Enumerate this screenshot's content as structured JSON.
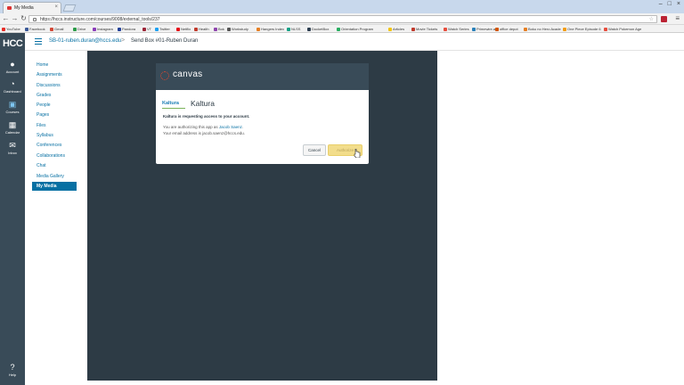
{
  "browser": {
    "tab_title": "My Media",
    "url": "https://hccs.instructure.com/courses/9008/external_tools/237",
    "bookmarks": [
      {
        "label": "YouTube",
        "color": "#e52d27"
      },
      {
        "label": "Facebook",
        "color": "#3b5998"
      },
      {
        "label": "Gmail",
        "color": "#d14836"
      },
      {
        "label": "Drive",
        "color": "#2b9b48"
      },
      {
        "label": "Instagram",
        "color": "#8a3ab9"
      },
      {
        "label": "Pandora",
        "color": "#224099"
      },
      {
        "label": "VT",
        "color": "#9b2335"
      },
      {
        "label": "Twitter",
        "color": "#1da1f2"
      },
      {
        "label": "Netflix",
        "color": "#e50914"
      },
      {
        "label": "Health",
        "color": "#c0392b"
      },
      {
        "label": "Bok",
        "color": "#8e44ad"
      },
      {
        "label": "Workstudy",
        "color": "#555555"
      },
      {
        "label": "Hangers Index",
        "color": "#e67e22"
      },
      {
        "label": "NLSS",
        "color": "#16a085"
      },
      {
        "label": "DocketBox",
        "color": "#2c3e50"
      },
      {
        "label": "Orientation Program",
        "color": "#27ae60"
      },
      {
        "label": "Articles",
        "color": "#f1c40f"
      },
      {
        "label": "Movie Tickets",
        "color": "#c0392b"
      },
      {
        "label": "Watch Series",
        "color": "#e74c3c"
      },
      {
        "label": "Primewire.ag",
        "color": "#2980b9"
      },
      {
        "label": "office depot",
        "color": "#d35400"
      },
      {
        "label": "Boku no Hero Acade",
        "color": "#e67e22"
      },
      {
        "label": "One Piece Episode 6",
        "color": "#f39c12"
      },
      {
        "label": "Watch Pokemon Age",
        "color": "#e74c3c"
      }
    ]
  },
  "global_nav": {
    "logo": "HCC",
    "items": [
      {
        "label": "Account",
        "icon": "account-icon"
      },
      {
        "label": "Dashboard",
        "icon": "dashboard-icon"
      },
      {
        "label": "Courses",
        "icon": "courses-icon"
      },
      {
        "label": "Calendar",
        "icon": "calendar-icon"
      },
      {
        "label": "Inbox",
        "icon": "inbox-icon"
      },
      {
        "label": "Help",
        "icon": "help-icon"
      }
    ]
  },
  "header": {
    "course": "SB-01-ruben.duran@hccs.edu",
    "separator": ">",
    "page": "Send Box #01-Ruben Duran"
  },
  "course_nav": {
    "items": [
      "Home",
      "Assignments",
      "Discussions",
      "Grades",
      "People",
      "Pages",
      "Files",
      "Syllabus",
      "Conferences",
      "Collaborations",
      "Chat",
      "Media Gallery",
      "My Media"
    ],
    "active_index": 12
  },
  "oauth": {
    "brand": "canvas",
    "app_logo_text": "Kaltura",
    "app_name": "Kaltura",
    "request_text": "Kaltura is requesting access to your account.",
    "authorizing_prefix": "You are authorizing this app as ",
    "user_name": "Jacob Saenz",
    "authorizing_suffix": ".",
    "email_text": "Your email address is jacob.saenz@hccs.edu.",
    "cancel_label": "Cancel",
    "authorize_label": "Authorize"
  },
  "colors": {
    "canvas_nav": "#394b58",
    "canvas_blue": "#0770a3",
    "content_dark": "#2d3b45",
    "authorize_btn": "#f2dd8c"
  }
}
